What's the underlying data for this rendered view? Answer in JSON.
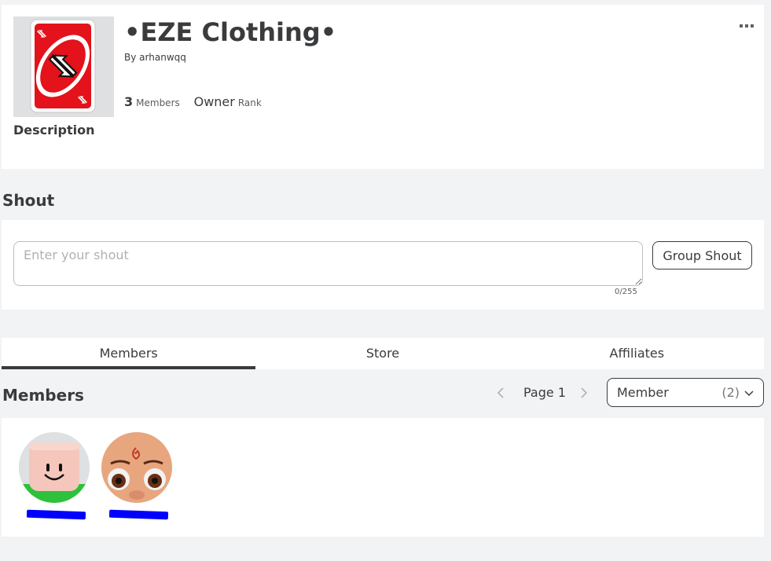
{
  "group": {
    "name": "•EZE Clothing•",
    "by_prefix": "By",
    "owner": "arhanwqq",
    "member_count": "3",
    "members_label": "Members",
    "rank_value": "Owner",
    "rank_label": "Rank",
    "description_heading": "Description",
    "emblem_icon": "uno-reverse-card-icon"
  },
  "shout": {
    "heading": "Shout",
    "placeholder": "Enter your shout",
    "char_count": "0/255",
    "button_label": "Group Shout"
  },
  "tabs": [
    {
      "label": "Members",
      "active": true
    },
    {
      "label": "Store",
      "active": false
    },
    {
      "label": "Affiliates",
      "active": false
    }
  ],
  "members_section": {
    "heading": "Members",
    "page_label": "Page 1",
    "role_select": {
      "name": "Member",
      "count": "(2)"
    }
  },
  "members": [
    {
      "avatar": "classic-smile-avatar-icon"
    },
    {
      "avatar": "face-avatar-icon"
    }
  ],
  "colors": {
    "background": "#f2f3f5",
    "text": "#393b3d",
    "redaction": "#0000ff"
  }
}
